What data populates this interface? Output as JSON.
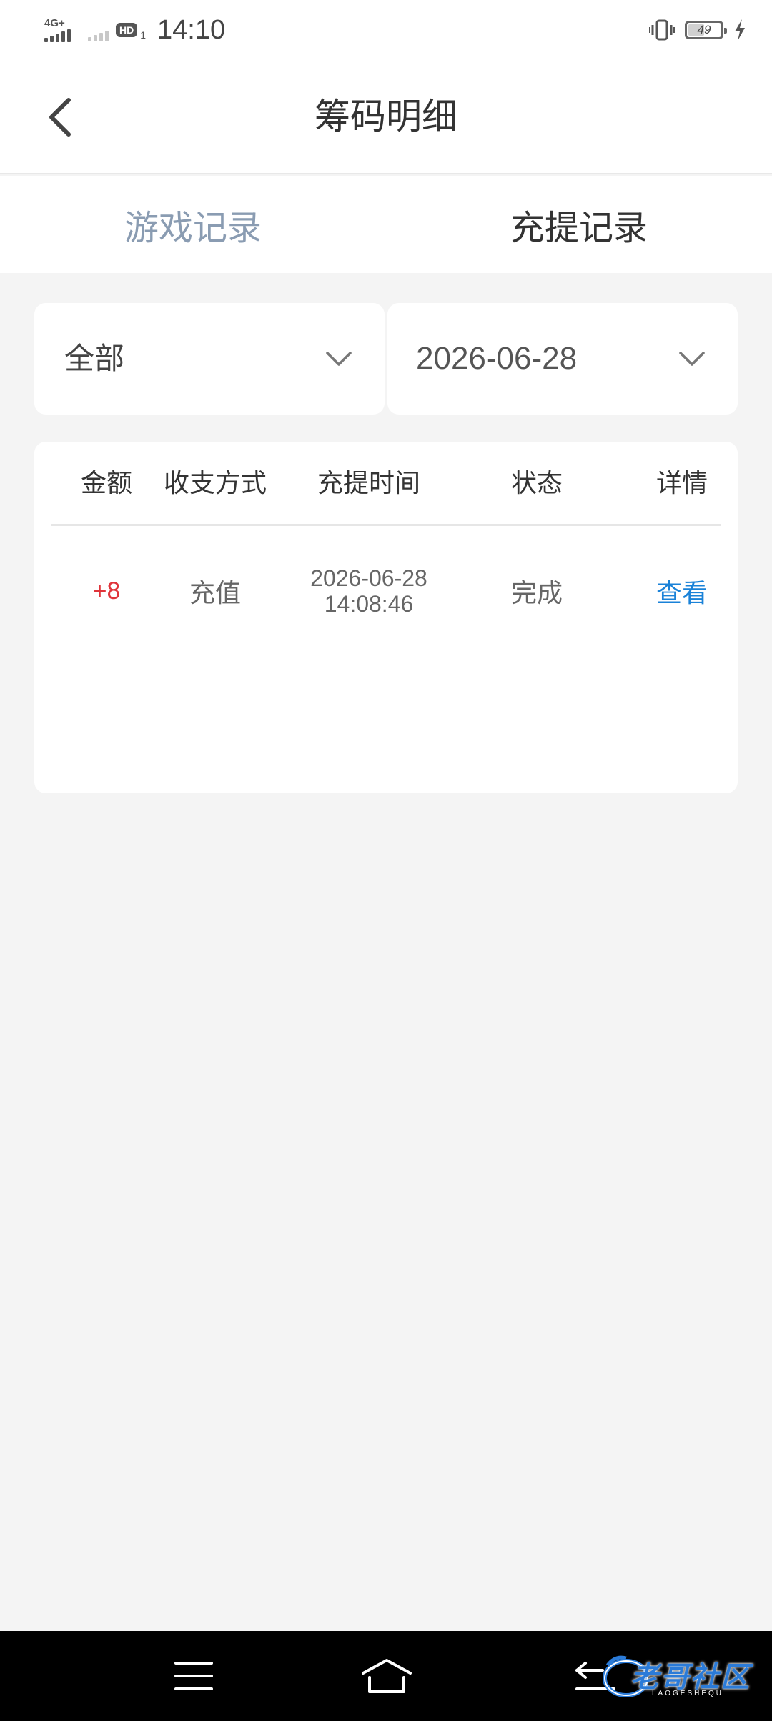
{
  "status_bar": {
    "network_type": "4G+",
    "hd_label": "HD",
    "sim_slot": "1",
    "time": "14:10",
    "battery_level": "49"
  },
  "header": {
    "title": "筹码明细"
  },
  "tabs": [
    {
      "label": "游戏记录",
      "active": false
    },
    {
      "label": "充提记录",
      "active": true
    }
  ],
  "filters": {
    "type_selected": "全部",
    "date_selected": "2026-06-28"
  },
  "table": {
    "columns": [
      "金额",
      "收支方式",
      "充提时间",
      "状态",
      "详情"
    ],
    "rows": [
      {
        "amount": "+8",
        "method": "充值",
        "date": "2026-06-28",
        "time": "14:08:46",
        "status": "完成",
        "detail": "查看"
      }
    ]
  },
  "colors": {
    "amount_positive": "#e0343a",
    "link": "#1a82d8",
    "tab_inactive": "#8a9cb2",
    "background": "#f4f4f4"
  },
  "navbar": {
    "watermark": "老哥社区",
    "watermark_sub": "LAOGESHEQU"
  },
  "icons": {
    "back": "chevron-left-icon",
    "dropdown": "chevron-down-icon",
    "nav_menu": "menu-icon",
    "nav_home": "home-icon",
    "nav_back": "back-icon"
  }
}
